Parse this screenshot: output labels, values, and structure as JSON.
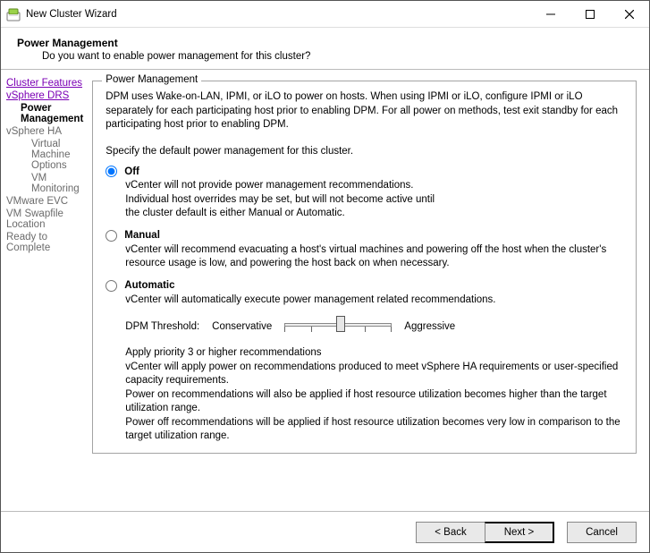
{
  "titlebar": {
    "title": "New Cluster Wizard"
  },
  "header": {
    "title": "Power Management",
    "subtitle": "Do you want to enable power management for this cluster?"
  },
  "sidebar": {
    "items": [
      {
        "label": "Cluster Features",
        "kind": "visited"
      },
      {
        "label": "vSphere DRS",
        "kind": "visited"
      },
      {
        "label": "Power Management",
        "kind": "current"
      },
      {
        "label": "vSphere HA",
        "kind": "future"
      },
      {
        "label": "Virtual Machine Options",
        "kind": "sub"
      },
      {
        "label": "VM Monitoring",
        "kind": "sub"
      },
      {
        "label": "VMware EVC",
        "kind": "future"
      },
      {
        "label": "VM Swapfile Location",
        "kind": "future"
      },
      {
        "label": "Ready to Complete",
        "kind": "future"
      }
    ]
  },
  "content": {
    "legend": "Power Management",
    "intro": "DPM uses Wake-on-LAN, IPMI, or iLO to power on hosts. When using IPMI or iLO, configure IPMI or iLO separately for each participating host prior to enabling DPM. For all power on methods, test exit standby for each participating host prior to enabling DPM.",
    "specify": "Specify the default power management for this cluster.",
    "options": {
      "off": {
        "label": "Off",
        "desc": "vCenter will not provide power management recommendations.\nIndividual host overrides may be set, but will not become active until\nthe cluster default is either Manual or Automatic."
      },
      "manual": {
        "label": "Manual",
        "desc": "vCenter will recommend evacuating a host's virtual machines and powering off the host when the cluster's resource usage is low, and powering the host back on when necessary."
      },
      "automatic": {
        "label": "Automatic",
        "desc": "vCenter will automatically execute power management related recommendations."
      }
    },
    "threshold": {
      "label": "DPM Threshold:",
      "left": "Conservative",
      "right": "Aggressive"
    },
    "apply": "Apply priority 3 or higher recommendations\nvCenter will apply power on recommendations produced to meet vSphere HA requirements or user-specified capacity requirements.\nPower on recommendations will also be applied if host resource utilization becomes higher than the target utilization range.\nPower off recommendations will be applied if host resource utilization becomes very low in comparison to the target utilization range."
  },
  "footer": {
    "back": "< Back",
    "next": "Next >",
    "cancel": "Cancel"
  }
}
